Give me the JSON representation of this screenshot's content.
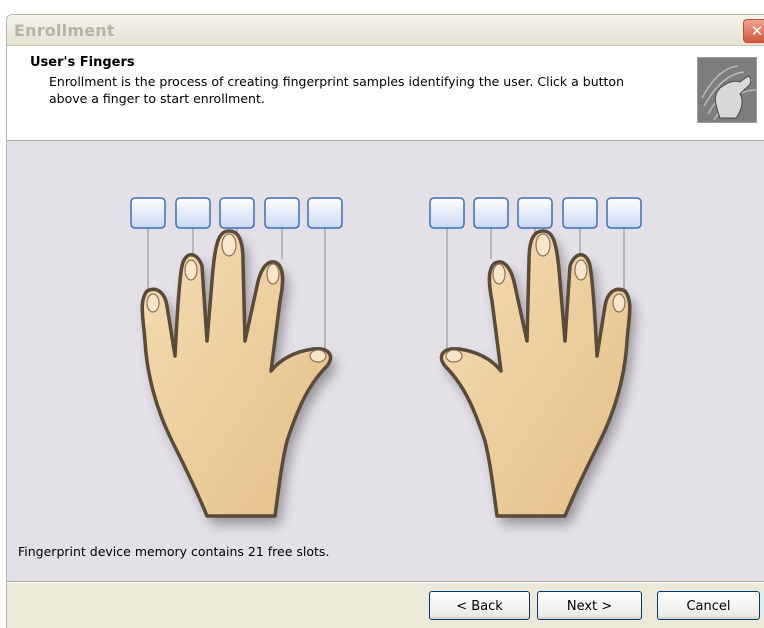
{
  "window": {
    "title": "Enrollment",
    "close_glyph": "✕"
  },
  "header": {
    "title": "User's Fingers",
    "description": "Enrollment is the process of creating fingerprint samples identifying the user. Click a button above a finger to start enrollment.",
    "image_icon": "fingerprint-hand-icon"
  },
  "status": {
    "text": "Fingerprint device memory contains 21 free slots."
  },
  "buttons": {
    "back": "< Back",
    "next": "Next >",
    "cancel": "Cancel"
  },
  "colors": {
    "skin": "#efcf9e",
    "outline": "#5a4a3a",
    "finger_button": "#dfe9f8",
    "finger_button_border": "#3c6fb3",
    "panel_background": "#e3e0e7"
  }
}
